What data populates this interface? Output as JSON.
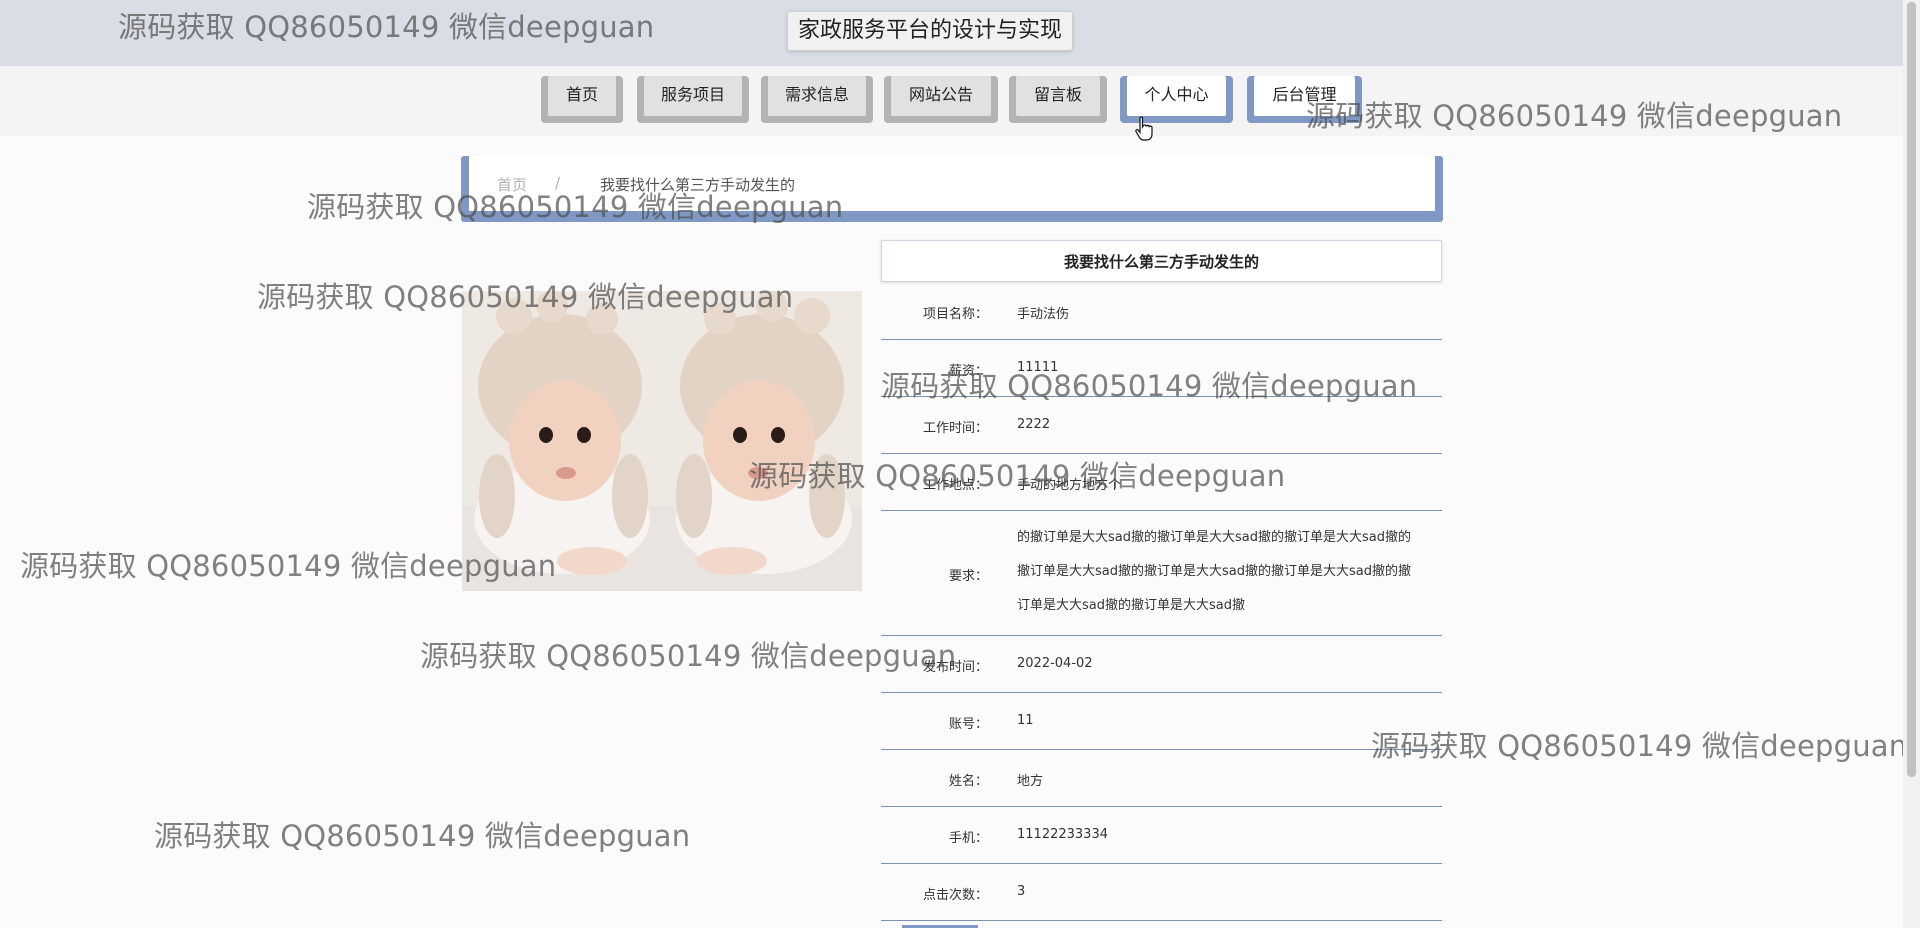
{
  "header": {
    "title": "家政服务平台的设计与实现"
  },
  "nav": {
    "items": [
      "首页",
      "服务项目",
      "需求信息",
      "网站公告",
      "留言板",
      "个人中心",
      "后台管理"
    ]
  },
  "breadcrumb": {
    "home": "首页",
    "separator": "/",
    "current": "我要找什么第三方手动发生的"
  },
  "detail": {
    "title": "我要找什么第三方手动发生的",
    "fields": [
      {
        "label": "项目名称：",
        "value": "手动法伤"
      },
      {
        "label": "薪资：",
        "value": "11111"
      },
      {
        "label": "工作时间：",
        "value": "2222"
      },
      {
        "label": "工作地点：",
        "value": "手动的地方地方个"
      },
      {
        "label": "要求：",
        "value": "的撤订单是大大sad撤的撤订单是大大sad撤的撤订单是大大sad撤的撤订单是大大sad撤的撤订单是大大sad撤的撤订单是大大sad撤的撤订单是大大sad撤的撤订单是大大sad撤"
      },
      {
        "label": "发布时间：",
        "value": "2022-04-02"
      },
      {
        "label": "账号：",
        "value": "11"
      },
      {
        "label": "姓名：",
        "value": "地方"
      },
      {
        "label": "手机：",
        "value": "11122233334"
      },
      {
        "label": "点击次数：",
        "value": "3"
      }
    ]
  },
  "watermark": "源码获取 QQ86050149 微信deepguan",
  "colors": {
    "accent": "#7f98c4",
    "header": "#d9dde5",
    "divider": "#7d92ad"
  }
}
